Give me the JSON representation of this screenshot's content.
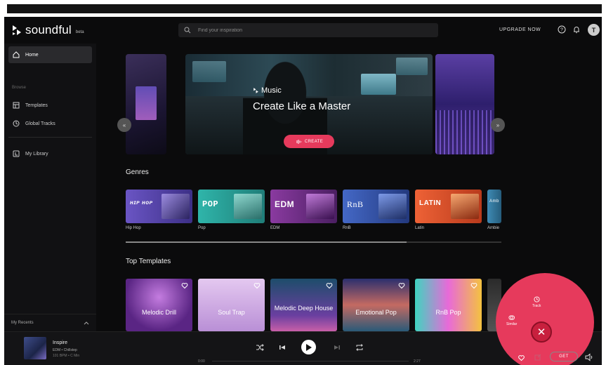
{
  "header": {
    "logo_text": "soundful",
    "logo_badge": "beta",
    "search_placeholder": "Find your inspiration",
    "upgrade_label": "UPGRADE NOW",
    "avatar_initial": "T"
  },
  "sidebar": {
    "items": [
      {
        "label": "Home",
        "icon": "home-icon",
        "active": true
      },
      {
        "label": "Templates",
        "icon": "templates-icon"
      },
      {
        "label": "Global Tracks",
        "icon": "global-icon"
      },
      {
        "label": "My Library",
        "icon": "library-icon"
      }
    ],
    "browse_label": "Browse",
    "recents_label": "My Recents"
  },
  "hero": {
    "brand": "Music",
    "title": "Create Like a Master",
    "button_label": "CREATE"
  },
  "genres": {
    "title": "Genres",
    "items": [
      {
        "word": "ʜɪᴘ ʜᴏᴘ",
        "label": "Hip Hop",
        "color": "#5a4aa8"
      },
      {
        "word": "POP",
        "label": "Pop",
        "color": "#2aa39a"
      },
      {
        "word": "EDM",
        "label": "EDM",
        "color": "#7a2f8f"
      },
      {
        "word": "RnB",
        "label": "RnB",
        "color": "#3a5bb8"
      },
      {
        "word": "LATIN",
        "label": "Latin",
        "color": "#e2562f"
      },
      {
        "word": "Amb",
        "label": "Ambie",
        "color": "#3a7fa8"
      }
    ]
  },
  "templates": {
    "title": "Top Templates",
    "items": [
      {
        "label": "Melodic Drill"
      },
      {
        "label": "Soul Trap"
      },
      {
        "label": "Melodic Deep House"
      },
      {
        "label": "Emotional Pop"
      },
      {
        "label": "RnB Pop"
      }
    ]
  },
  "player": {
    "track_title": "Inspire",
    "track_genre": "EDM • Chillstep",
    "track_meta": "101 BPM • C Min",
    "time_start": "0:00",
    "time_end": "2:27",
    "get_label": "GET"
  },
  "fab": {
    "track_label": "Track",
    "similar_label": "Similar"
  }
}
